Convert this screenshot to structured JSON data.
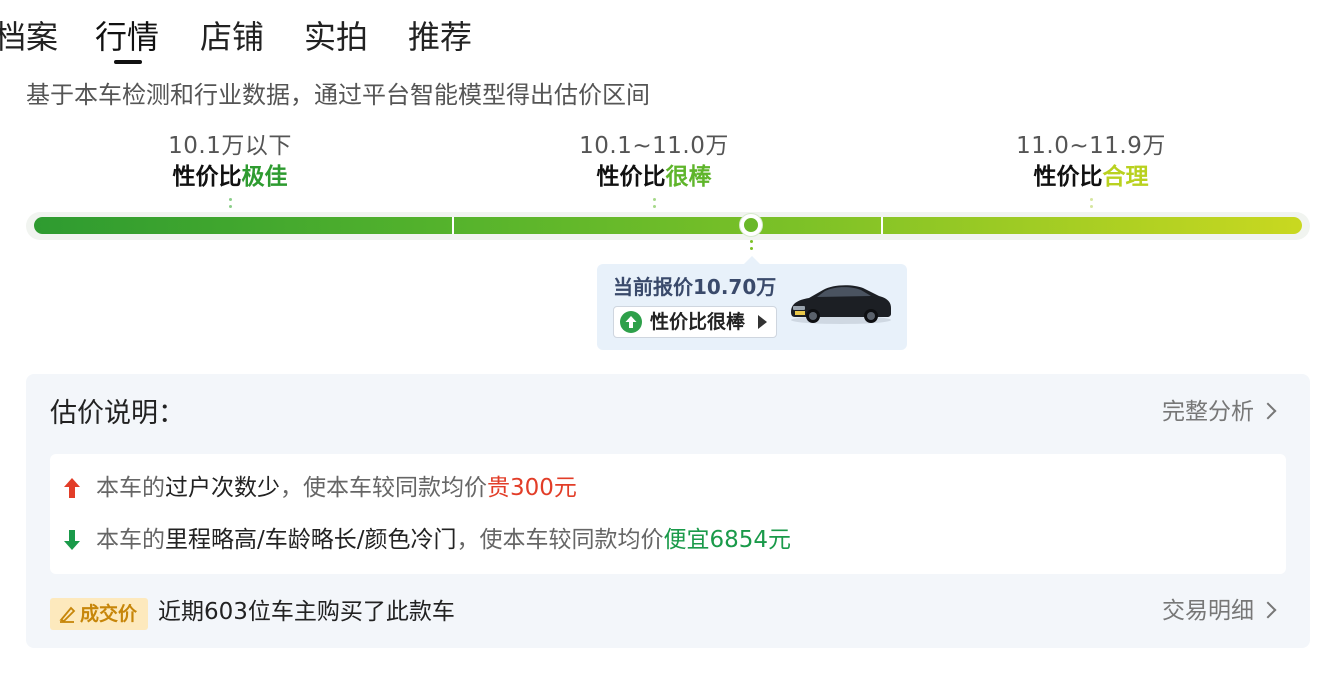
{
  "tabs": [
    {
      "label": "档案"
    },
    {
      "label": "行情"
    },
    {
      "label": "店铺"
    },
    {
      "label": "实拍"
    },
    {
      "label": "推荐"
    }
  ],
  "active_tab": "行情",
  "subtitle": "基于本车检测和行业数据，通过平台智能模型得出估价区间",
  "ranges": [
    {
      "price": "10.1万以下",
      "prefix": "性价比",
      "rating": "极佳",
      "color": "#2e9b30"
    },
    {
      "price": "10.1~11.0万",
      "prefix": "性价比",
      "rating": "很棒",
      "color": "#5fb52b"
    },
    {
      "price": "11.0~11.9万",
      "prefix": "性价比",
      "rating": "合理",
      "color": "#b9d11f"
    }
  ],
  "current": {
    "label": "当前报价10.70万",
    "value_badge": "性价比很棒",
    "position": 0.565
  },
  "explain": {
    "title": "估价说明：",
    "full_analysis": "完整分析",
    "reasons": [
      {
        "prefix": "本车的",
        "factor": "过户次数少",
        "middle": "，使本车较同款均价",
        "effect": "贵300元",
        "direction": "up"
      },
      {
        "prefix": "本车的",
        "factor": "里程略高/车龄略长/颜色冷门",
        "middle": "，使本车较同款均价",
        "effect": "便宜6854元",
        "direction": "down"
      }
    ],
    "deal_badge": "成交价",
    "deal_text": "近期603位车主购买了此款车",
    "trade_detail": "交易明细"
  },
  "colors": {
    "up_arrow": "#e23d28",
    "down_arrow": "#1a9a4a",
    "badge_bg": "#fde9bd"
  }
}
